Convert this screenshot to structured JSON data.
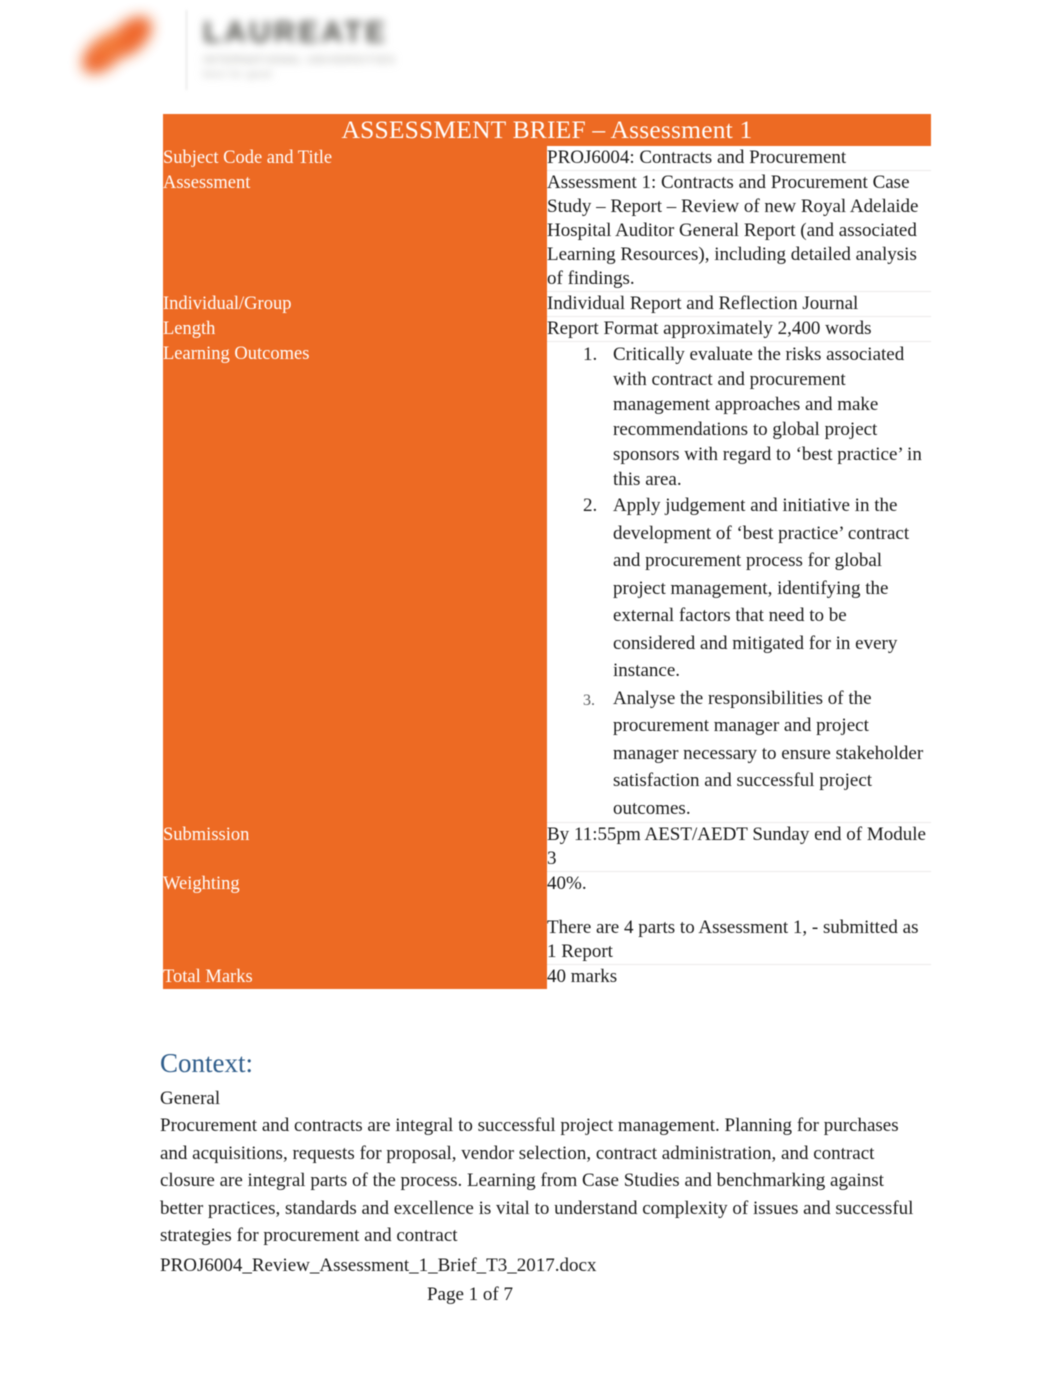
{
  "colors": {
    "brand_orange": "#ed6a23",
    "heading_blue": "#2e5c8a",
    "text_black": "#1a1a1a",
    "white": "#ffffff"
  },
  "logo": {
    "mark_name": "laureate-flame-mark",
    "wordmark": "LAUREATE",
    "tagline_line1": "INTERNATIONAL UNIVERSITIES",
    "tagline_line2": "here for good"
  },
  "table": {
    "header": "ASSESSMENT BRIEF – Assessment 1",
    "rows": [
      {
        "label": "Subject Code and Title",
        "value": "PROJ6004: Contracts and Procurement",
        "type": "text"
      },
      {
        "label": "Assessment",
        "value": "Assessment 1: Contracts and Procurement Case Study – Report – Review of new Royal Adelaide Hospital Auditor General Report (and associated Learning Resources), including detailed analysis of findings.",
        "type": "text"
      },
      {
        "label": "Individual/Group",
        "value": "Individual Report and Reflection Journal",
        "type": "text"
      },
      {
        "label": "Length",
        "value": "Report Format approximately 2,400 words",
        "type": "text"
      },
      {
        "label": "Learning Outcomes",
        "type": "list",
        "items": [
          "Critically evaluate the risks associated with contract and procurement management approaches and make recommendations to global project sponsors with regard to ‘best practice’ in this area.",
          "Apply judgement and initiative in the development of ‘best practice’ contract and procurement process for global project management, identifying the external factors that need to be considered and mitigated for in every instance.",
          "Analyse the responsibilities of the procurement manager and project manager necessary to ensure stakeholder satisfaction and successful project outcomes."
        ]
      },
      {
        "label": "Submission",
        "value": "By 11:55pm AEST/AEDT Sunday end of Module 3",
        "type": "text"
      },
      {
        "label": "Weighting",
        "type": "paragraphs",
        "paragraphs": [
          "40%.",
          "There are 4 parts to Assessment 1, - submitted as 1 Report"
        ]
      },
      {
        "label": "Total Marks",
        "value": "40 marks",
        "type": "text"
      }
    ]
  },
  "context": {
    "heading": "Context:",
    "subheading": "General",
    "paragraph": "Procurement and contracts are integral to successful project management. Planning for purchases and acquisitions, requests for proposal, vendor selection, contract administration, and contract closure are integral parts of the process.     Learning from Case Studies and benchmarking against better practices, standards and excellence is vital to understand complexity of issues and successful strategies for procurement and contract"
  },
  "footer": {
    "filename": "PROJ6004_Review_Assessment_1_Brief_T3_2017.docx",
    "page_label": "Page 1 of 7"
  }
}
